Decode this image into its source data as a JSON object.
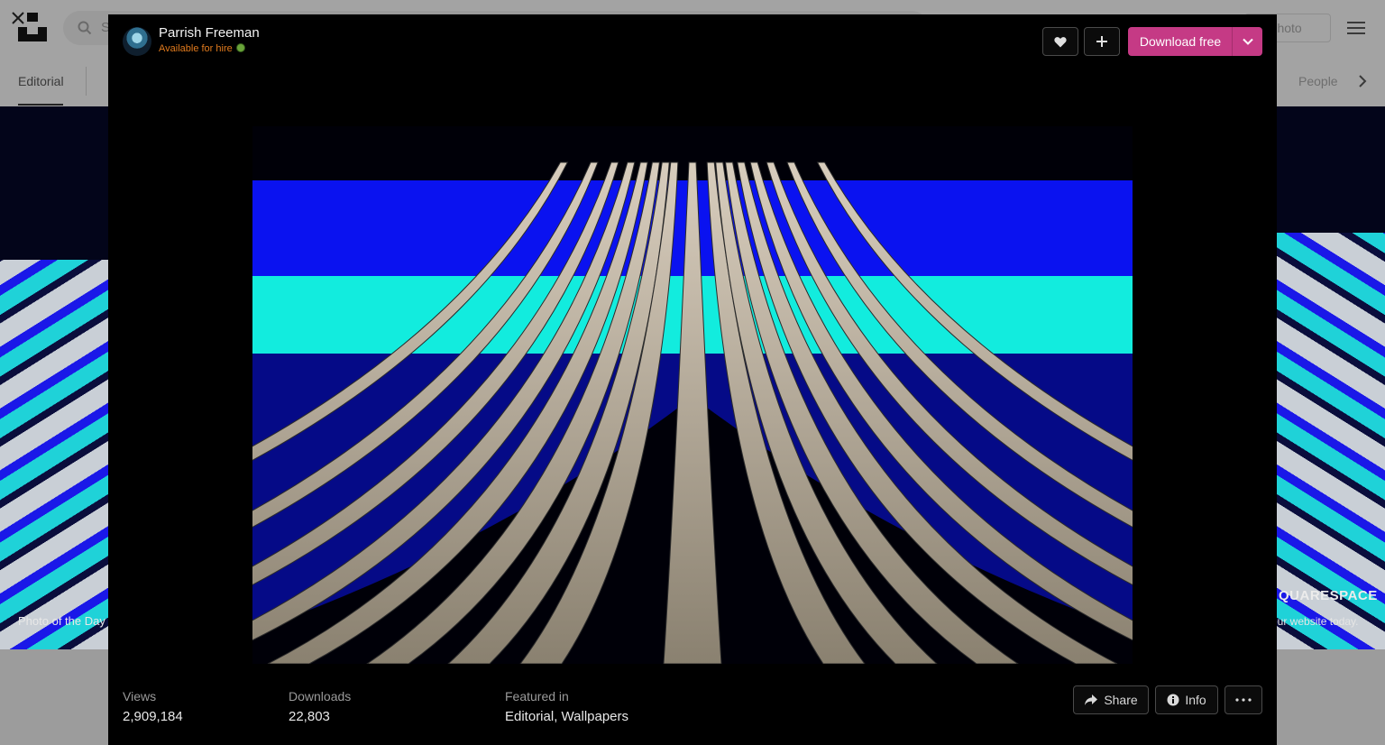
{
  "background": {
    "search": {
      "placeholder": "S"
    },
    "submit_label": "a photo",
    "tabs": {
      "active": "Editorial",
      "right": "People"
    },
    "hero": {
      "left_caption": "Photo of the Day",
      "sponsor_brand": "QUARESPACE",
      "sponsor_tagline": "our website today."
    }
  },
  "modal": {
    "author": {
      "name": "Parrish Freeman",
      "status": "Available for hire"
    },
    "actions": {
      "download_label": "Download free"
    },
    "stats": {
      "views_label": "Views",
      "views_value": "2,909,184",
      "downloads_label": "Downloads",
      "downloads_value": "22,803",
      "featured_label": "Featured in",
      "featured_items": [
        "Editorial",
        "Wallpapers"
      ],
      "featured_separator": ","
    },
    "footer_actions": {
      "share_label": "Share",
      "info_label": "Info"
    }
  },
  "icons": {
    "close": "close-icon",
    "like": "heart-icon",
    "add": "plus-icon",
    "download_more": "chevron-down-icon",
    "share": "share-icon",
    "info": "info-icon",
    "more": "ellipsis-icon",
    "search": "search-icon",
    "menu": "hamburger-icon",
    "next": "chevron-right-icon"
  },
  "colors": {
    "download_accent": "#c53a85",
    "hire_text": "#e07a1d",
    "photo_sky_blue": "#0a12f0",
    "photo_cyan": "#12ecde"
  }
}
